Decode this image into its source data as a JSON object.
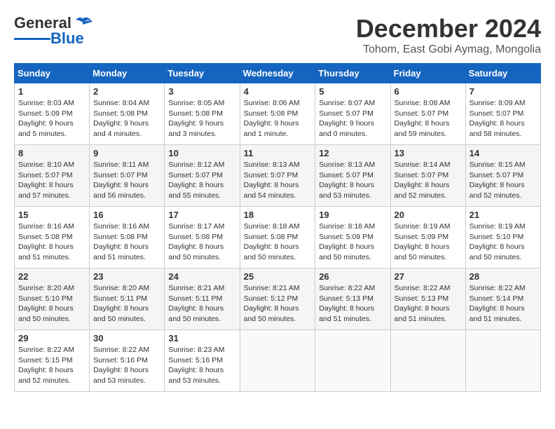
{
  "header": {
    "logo_general": "General",
    "logo_blue": "Blue",
    "month_title": "December 2024",
    "location": "Tohom, East Gobi Aymag, Mongolia"
  },
  "weekdays": [
    "Sunday",
    "Monday",
    "Tuesday",
    "Wednesday",
    "Thursday",
    "Friday",
    "Saturday"
  ],
  "weeks": [
    [
      {
        "day": "1",
        "sunrise": "Sunrise: 8:03 AM",
        "sunset": "Sunset: 5:09 PM",
        "daylight": "Daylight: 9 hours and 5 minutes."
      },
      {
        "day": "2",
        "sunrise": "Sunrise: 8:04 AM",
        "sunset": "Sunset: 5:08 PM",
        "daylight": "Daylight: 9 hours and 4 minutes."
      },
      {
        "day": "3",
        "sunrise": "Sunrise: 8:05 AM",
        "sunset": "Sunset: 5:08 PM",
        "daylight": "Daylight: 9 hours and 3 minutes."
      },
      {
        "day": "4",
        "sunrise": "Sunrise: 8:06 AM",
        "sunset": "Sunset: 5:08 PM",
        "daylight": "Daylight: 9 hours and 1 minute."
      },
      {
        "day": "5",
        "sunrise": "Sunrise: 8:07 AM",
        "sunset": "Sunset: 5:07 PM",
        "daylight": "Daylight: 9 hours and 0 minutes."
      },
      {
        "day": "6",
        "sunrise": "Sunrise: 8:08 AM",
        "sunset": "Sunset: 5:07 PM",
        "daylight": "Daylight: 8 hours and 59 minutes."
      },
      {
        "day": "7",
        "sunrise": "Sunrise: 8:09 AM",
        "sunset": "Sunset: 5:07 PM",
        "daylight": "Daylight: 8 hours and 58 minutes."
      }
    ],
    [
      {
        "day": "8",
        "sunrise": "Sunrise: 8:10 AM",
        "sunset": "Sunset: 5:07 PM",
        "daylight": "Daylight: 8 hours and 57 minutes."
      },
      {
        "day": "9",
        "sunrise": "Sunrise: 8:11 AM",
        "sunset": "Sunset: 5:07 PM",
        "daylight": "Daylight: 8 hours and 56 minutes."
      },
      {
        "day": "10",
        "sunrise": "Sunrise: 8:12 AM",
        "sunset": "Sunset: 5:07 PM",
        "daylight": "Daylight: 8 hours and 55 minutes."
      },
      {
        "day": "11",
        "sunrise": "Sunrise: 8:13 AM",
        "sunset": "Sunset: 5:07 PM",
        "daylight": "Daylight: 8 hours and 54 minutes."
      },
      {
        "day": "12",
        "sunrise": "Sunrise: 8:13 AM",
        "sunset": "Sunset: 5:07 PM",
        "daylight": "Daylight: 8 hours and 53 minutes."
      },
      {
        "day": "13",
        "sunrise": "Sunrise: 8:14 AM",
        "sunset": "Sunset: 5:07 PM",
        "daylight": "Daylight: 8 hours and 52 minutes."
      },
      {
        "day": "14",
        "sunrise": "Sunrise: 8:15 AM",
        "sunset": "Sunset: 5:07 PM",
        "daylight": "Daylight: 8 hours and 52 minutes."
      }
    ],
    [
      {
        "day": "15",
        "sunrise": "Sunrise: 8:16 AM",
        "sunset": "Sunset: 5:08 PM",
        "daylight": "Daylight: 8 hours and 51 minutes."
      },
      {
        "day": "16",
        "sunrise": "Sunrise: 8:16 AM",
        "sunset": "Sunset: 5:08 PM",
        "daylight": "Daylight: 8 hours and 51 minutes."
      },
      {
        "day": "17",
        "sunrise": "Sunrise: 8:17 AM",
        "sunset": "Sunset: 5:08 PM",
        "daylight": "Daylight: 8 hours and 50 minutes."
      },
      {
        "day": "18",
        "sunrise": "Sunrise: 8:18 AM",
        "sunset": "Sunset: 5:08 PM",
        "daylight": "Daylight: 8 hours and 50 minutes."
      },
      {
        "day": "19",
        "sunrise": "Sunrise: 8:18 AM",
        "sunset": "Sunset: 5:09 PM",
        "daylight": "Daylight: 8 hours and 50 minutes."
      },
      {
        "day": "20",
        "sunrise": "Sunrise: 8:19 AM",
        "sunset": "Sunset: 5:09 PM",
        "daylight": "Daylight: 8 hours and 50 minutes."
      },
      {
        "day": "21",
        "sunrise": "Sunrise: 8:19 AM",
        "sunset": "Sunset: 5:10 PM",
        "daylight": "Daylight: 8 hours and 50 minutes."
      }
    ],
    [
      {
        "day": "22",
        "sunrise": "Sunrise: 8:20 AM",
        "sunset": "Sunset: 5:10 PM",
        "daylight": "Daylight: 8 hours and 50 minutes."
      },
      {
        "day": "23",
        "sunrise": "Sunrise: 8:20 AM",
        "sunset": "Sunset: 5:11 PM",
        "daylight": "Daylight: 8 hours and 50 minutes."
      },
      {
        "day": "24",
        "sunrise": "Sunrise: 8:21 AM",
        "sunset": "Sunset: 5:11 PM",
        "daylight": "Daylight: 8 hours and 50 minutes."
      },
      {
        "day": "25",
        "sunrise": "Sunrise: 8:21 AM",
        "sunset": "Sunset: 5:12 PM",
        "daylight": "Daylight: 8 hours and 50 minutes."
      },
      {
        "day": "26",
        "sunrise": "Sunrise: 8:22 AM",
        "sunset": "Sunset: 5:13 PM",
        "daylight": "Daylight: 8 hours and 51 minutes."
      },
      {
        "day": "27",
        "sunrise": "Sunrise: 8:22 AM",
        "sunset": "Sunset: 5:13 PM",
        "daylight": "Daylight: 8 hours and 51 minutes."
      },
      {
        "day": "28",
        "sunrise": "Sunrise: 8:22 AM",
        "sunset": "Sunset: 5:14 PM",
        "daylight": "Daylight: 8 hours and 51 minutes."
      }
    ],
    [
      {
        "day": "29",
        "sunrise": "Sunrise: 8:22 AM",
        "sunset": "Sunset: 5:15 PM",
        "daylight": "Daylight: 8 hours and 52 minutes."
      },
      {
        "day": "30",
        "sunrise": "Sunrise: 8:22 AM",
        "sunset": "Sunset: 5:16 PM",
        "daylight": "Daylight: 8 hours and 53 minutes."
      },
      {
        "day": "31",
        "sunrise": "Sunrise: 8:23 AM",
        "sunset": "Sunset: 5:16 PM",
        "daylight": "Daylight: 8 hours and 53 minutes."
      },
      null,
      null,
      null,
      null
    ]
  ]
}
